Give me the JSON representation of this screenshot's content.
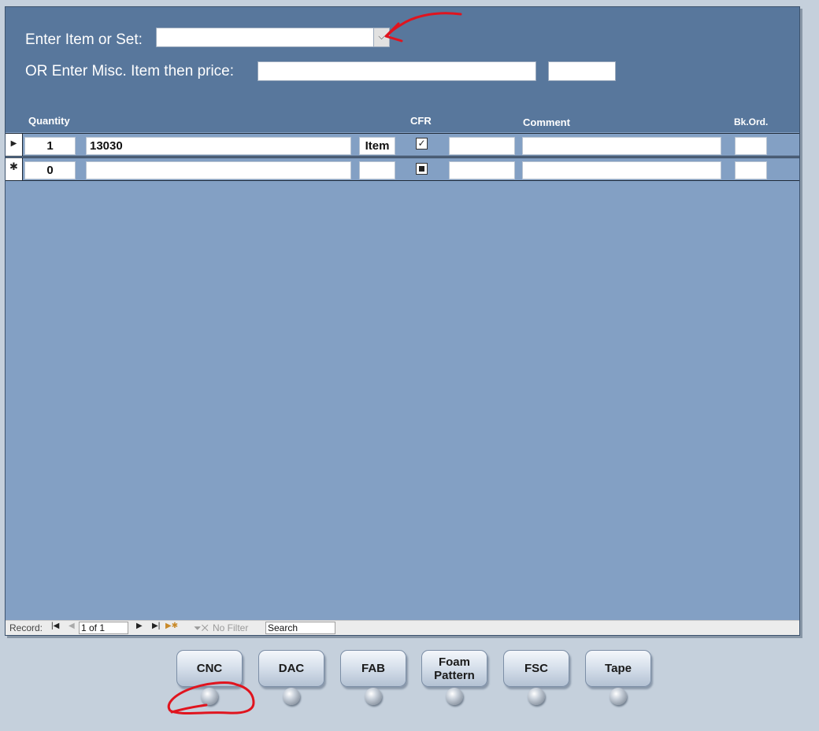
{
  "form": {
    "enter_item_label": "Enter Item or Set:",
    "enter_item_value": "",
    "misc_label": "OR Enter Misc. Item then price:",
    "misc_item_value": "",
    "misc_price_value": ""
  },
  "columns": {
    "quantity": "Quantity",
    "cfr": "CFR",
    "comment": "Comment",
    "bkord": "Bk.Ord."
  },
  "rows": [
    {
      "selector": "▶",
      "quantity": "1",
      "item": "13030",
      "type": "Item",
      "cfr": "checked",
      "comment": ""
    },
    {
      "selector": "✱",
      "quantity": "0",
      "item": "",
      "type": "",
      "cfr": "null",
      "comment": ""
    }
  ],
  "navigation": {
    "record_label": "Record:",
    "position": "1 of 1",
    "filter_label": "No Filter",
    "search_placeholder": "Search"
  },
  "buttons": [
    {
      "id": "cnc",
      "label": "CNC"
    },
    {
      "id": "dac",
      "label": "DAC"
    },
    {
      "id": "fab",
      "label": "FAB"
    },
    {
      "id": "foam",
      "label": "Foam Pattern"
    },
    {
      "id": "fsc",
      "label": "FSC"
    },
    {
      "id": "tape",
      "label": "Tape"
    }
  ],
  "colors": {
    "header_bg": "#58779c",
    "detail_bg": "#83a0c4",
    "page_bg": "#c5d0dc",
    "annotation": "#e0141e"
  }
}
